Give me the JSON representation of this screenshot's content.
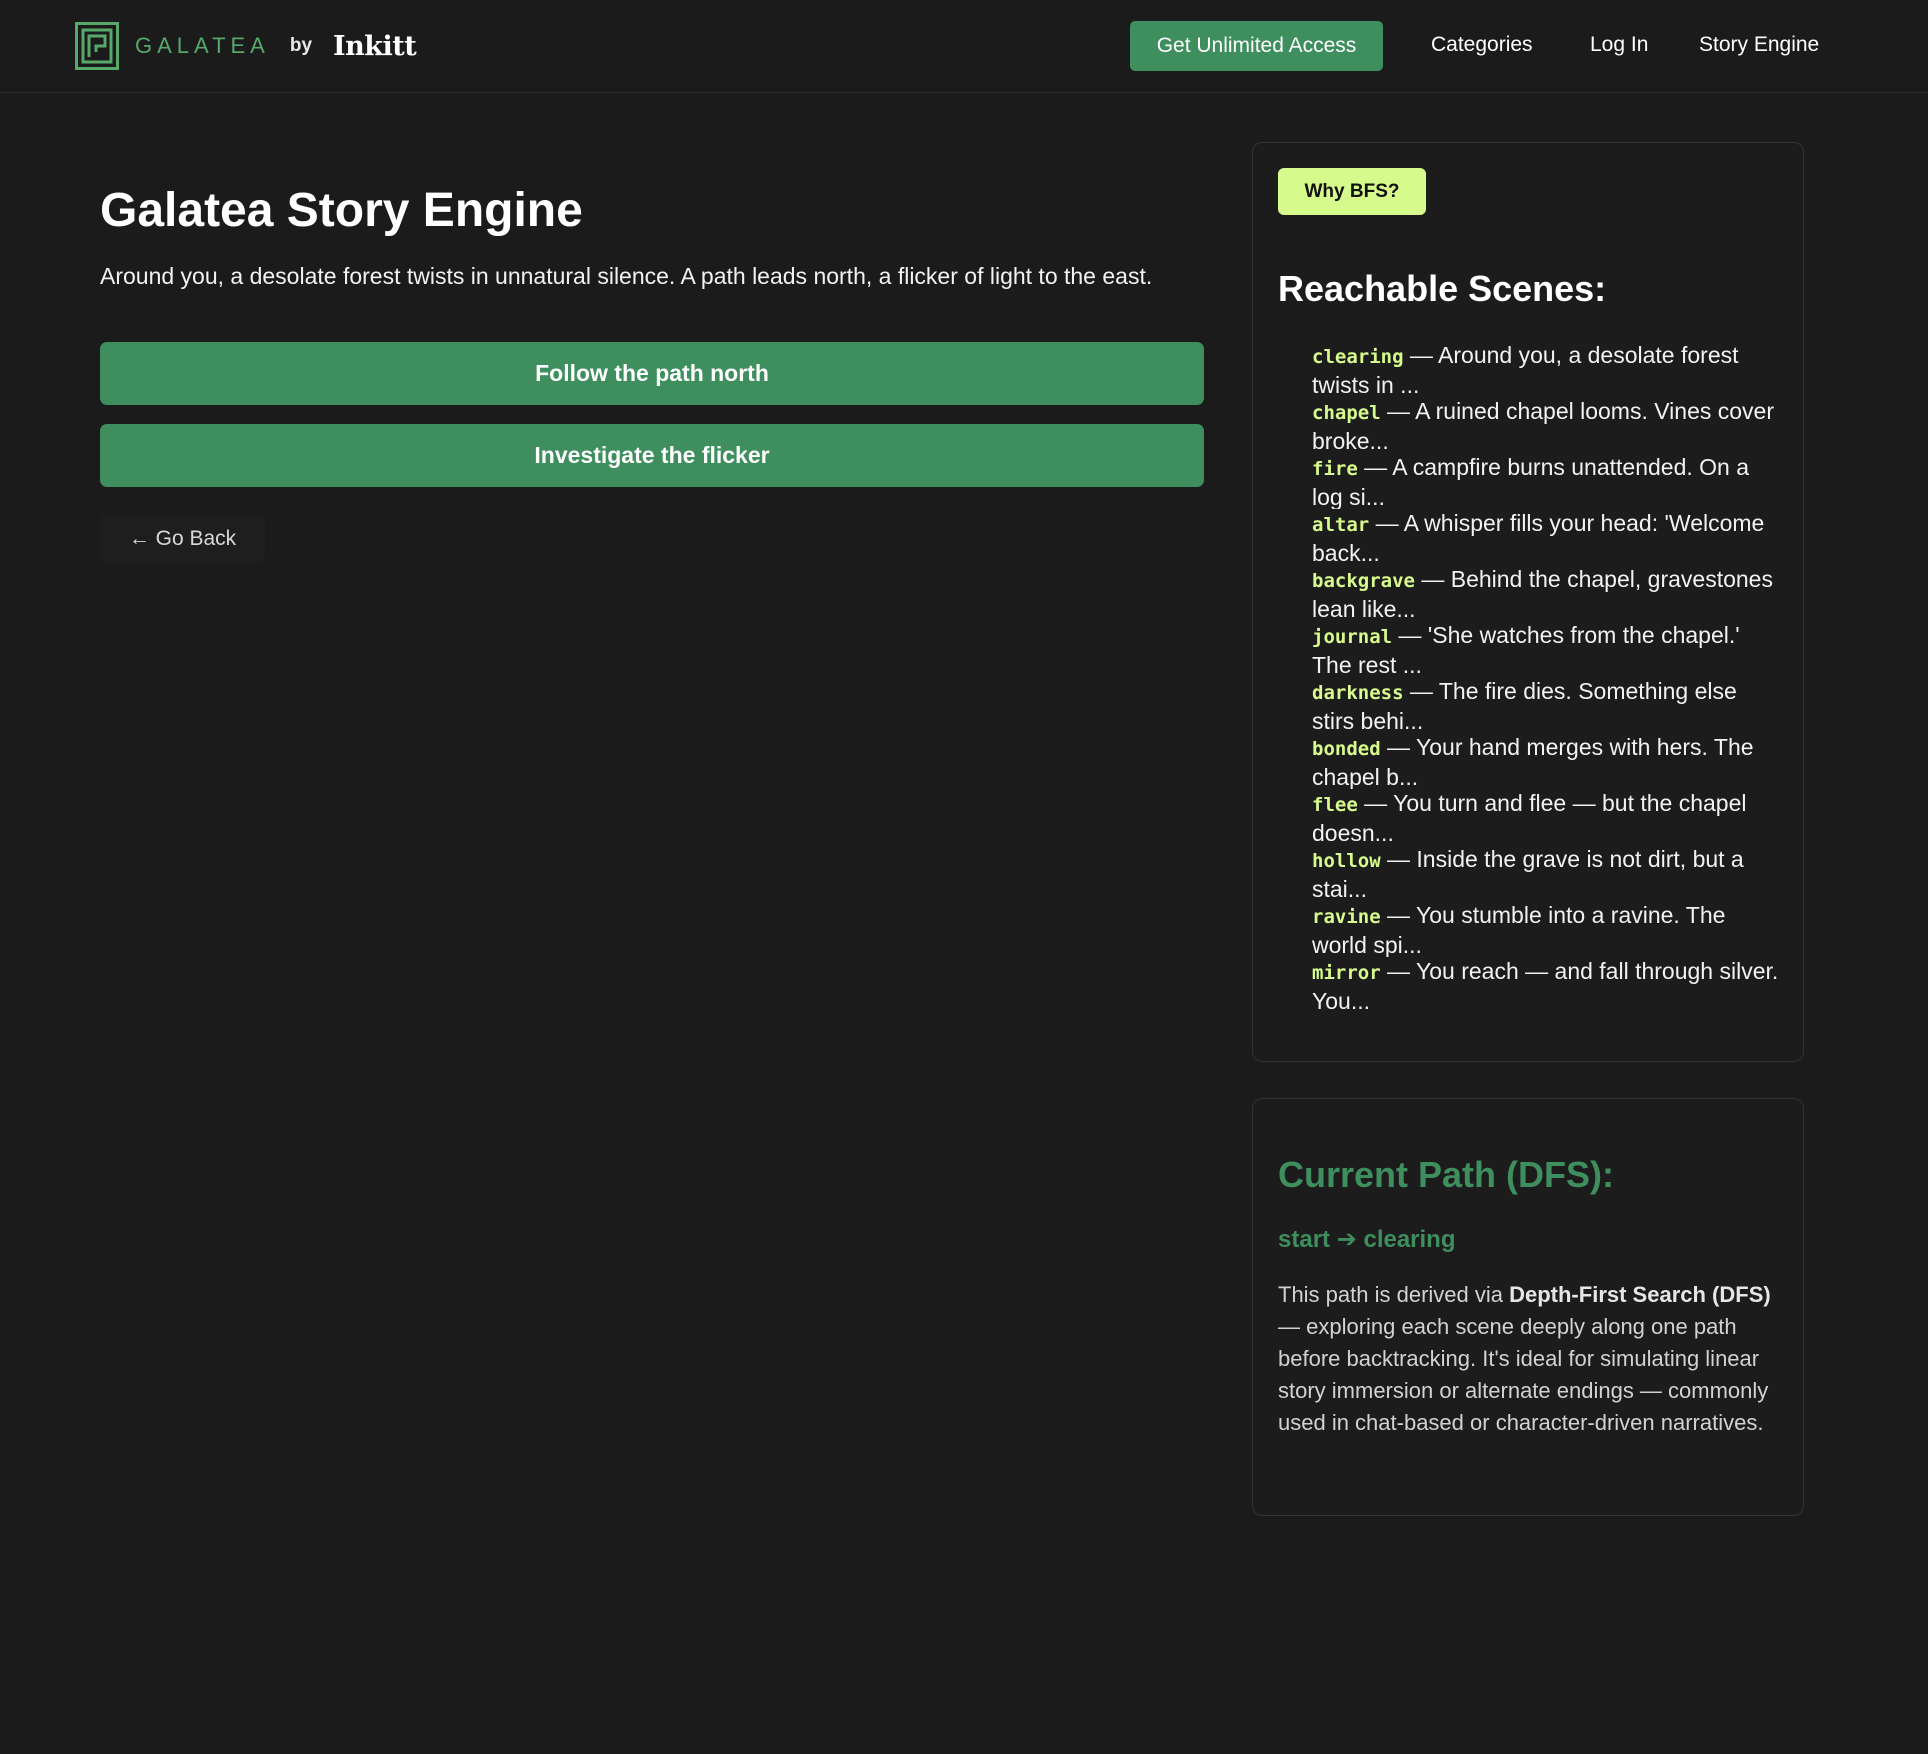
{
  "header": {
    "logo_word": "GALATEA",
    "logo_by": "by",
    "logo_inkitt": "Inkitt",
    "cta": "Get Unlimited Access",
    "nav": [
      "Categories",
      "Log In",
      "Story Engine"
    ]
  },
  "main": {
    "title": "Galatea Story Engine",
    "scene_text": "Around you, a desolate forest twists in unnatural silence. A path leads north, a flicker of light to the east.",
    "choices": [
      "Follow the path north",
      "Investigate the flicker"
    ],
    "back": "← Go Back"
  },
  "bfs": {
    "button": "Why BFS?",
    "heading": "Reachable Scenes:",
    "scenes": [
      {
        "key": "clearing",
        "text": " — Around you, a desolate forest twists in ..."
      },
      {
        "key": "chapel",
        "text": " — A ruined chapel looms. Vines cover broke..."
      },
      {
        "key": "fire",
        "text": " — A campfire burns unattended. On a log si..."
      },
      {
        "key": "altar",
        "text": " — A whisper fills your head: 'Welcome back..."
      },
      {
        "key": "backgrave",
        "text": " — Behind the chapel, gravestones lean like..."
      },
      {
        "key": "journal",
        "text": " — 'She watches from the chapel.' The rest ..."
      },
      {
        "key": "darkness",
        "text": " — The fire dies. Something else stirs behi..."
      },
      {
        "key": "bonded",
        "text": " — Your hand merges with hers. The chapel b..."
      },
      {
        "key": "flee",
        "text": " — You turn and flee — but the chapel doesn..."
      },
      {
        "key": "hollow",
        "text": " — Inside the grave is not dirt, but a stai..."
      },
      {
        "key": "ravine",
        "text": " — You stumble into a ravine. The world spi..."
      },
      {
        "key": "mirror",
        "text": " — You reach — and fall through silver. You..."
      }
    ]
  },
  "dfs": {
    "heading": "Current Path (DFS):",
    "path": "start ➔ clearing",
    "desc_prefix": "This path is derived via ",
    "desc_bold": "Depth-First Search (DFS)",
    "desc_suffix": " — exploring each scene deeply along one path before backtracking. It's ideal for simulating linear story immersion or alternate endings — commonly used in chat-based or character-driven narratives."
  },
  "colors": {
    "brand_green": "#3e8e5e",
    "accent_lime": "#d6fb8c",
    "background": "#1b1b1b"
  }
}
